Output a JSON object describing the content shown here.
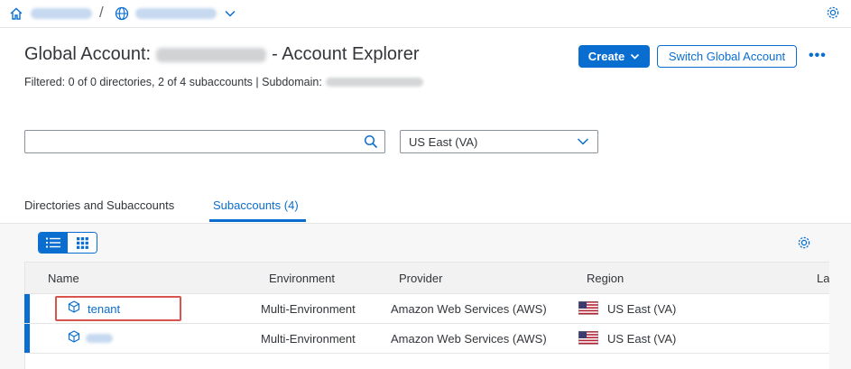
{
  "colors": {
    "accent": "#0a6ed1",
    "highlight": "#d9534f"
  },
  "breadcrumb": {
    "separator": "/"
  },
  "header": {
    "title_prefix": "Global Account:",
    "title_suffix": "- Account Explorer",
    "subtitle_prefix": "Filtered: 0 of 0 directories, 2 of 4 subaccounts | Subdomain:",
    "create_label": "Create",
    "switch_label": "Switch Global Account",
    "more_label": "•••"
  },
  "filters": {
    "search_value": "",
    "region_selected": "US East (VA)"
  },
  "tabs": [
    {
      "label": "Directories and Subaccounts"
    },
    {
      "label": "Subaccounts (4)"
    }
  ],
  "table": {
    "columns": [
      "Name",
      "Environment",
      "Provider",
      "Region",
      "La"
    ],
    "rows": [
      {
        "name": "tenant",
        "environment": "Multi-Environment",
        "provider": "Amazon Web Services (AWS)",
        "region": "US East (VA)",
        "flag": "us-flag-icon"
      },
      {
        "name": "",
        "environment": "Multi-Environment",
        "provider": "Amazon Web Services (AWS)",
        "region": "US East (VA)",
        "flag": "us-flag-icon"
      }
    ]
  }
}
